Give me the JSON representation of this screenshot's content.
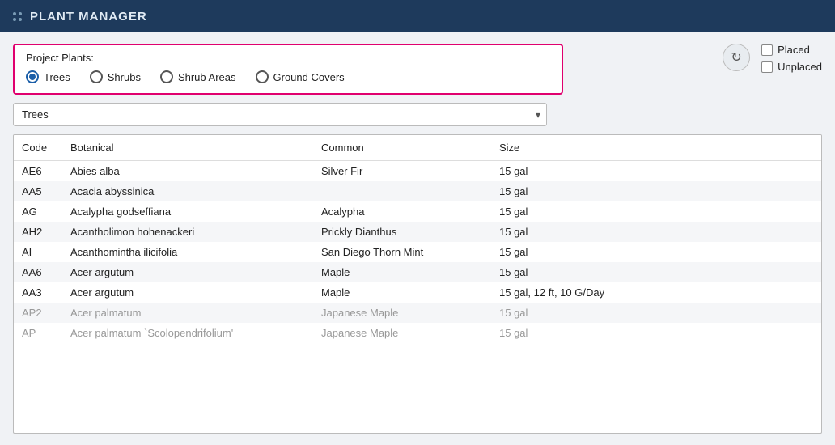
{
  "titleBar": {
    "dotsLabel": "drag-handle",
    "title": "PLANT MANAGER"
  },
  "projectPlants": {
    "label": "Project Plants:",
    "options": [
      {
        "id": "trees",
        "label": "Trees",
        "selected": true
      },
      {
        "id": "shrubs",
        "label": "Shrubs",
        "selected": false
      },
      {
        "id": "shrub-areas",
        "label": "Shrub Areas",
        "selected": false
      },
      {
        "id": "ground-covers",
        "label": "Ground Covers",
        "selected": false
      }
    ]
  },
  "dropdown": {
    "value": "Trees",
    "placeholder": "Trees"
  },
  "buttons": {
    "refresh": "↻",
    "placed": "Placed",
    "unplaced": "Unplaced"
  },
  "table": {
    "columns": [
      "Code",
      "Botanical",
      "Common",
      "Size"
    ],
    "rows": [
      {
        "code": "AE6",
        "botanical": "Abies alba",
        "common": "Silver Fir",
        "size": "15 gal",
        "dimmed": false
      },
      {
        "code": "AA5",
        "botanical": "Acacia abyssinica",
        "common": "",
        "size": "15 gal",
        "dimmed": false
      },
      {
        "code": "AG",
        "botanical": "Acalypha godseffiana",
        "common": "Acalypha",
        "size": "15 gal",
        "dimmed": false
      },
      {
        "code": "AH2",
        "botanical": "Acantholimon hohenackeri",
        "common": "Prickly Dianthus",
        "size": "15 gal",
        "dimmed": false
      },
      {
        "code": "AI",
        "botanical": "Acanthomintha ilicifolia",
        "common": "San Diego Thorn Mint",
        "size": "15 gal",
        "dimmed": false
      },
      {
        "code": "AA6",
        "botanical": "Acer argutum",
        "common": "Maple",
        "size": "15 gal",
        "dimmed": false
      },
      {
        "code": "AA3",
        "botanical": "Acer argutum",
        "common": "Maple",
        "size": "15 gal, 12 ft, 10 G/Day",
        "dimmed": false
      },
      {
        "code": "AP2",
        "botanical": "Acer palmatum",
        "common": "Japanese Maple",
        "size": "15 gal",
        "dimmed": true
      },
      {
        "code": "AP",
        "botanical": "Acer palmatum `Scolopendrifolium'",
        "common": "Japanese Maple",
        "size": "15 gal",
        "dimmed": true
      }
    ]
  }
}
